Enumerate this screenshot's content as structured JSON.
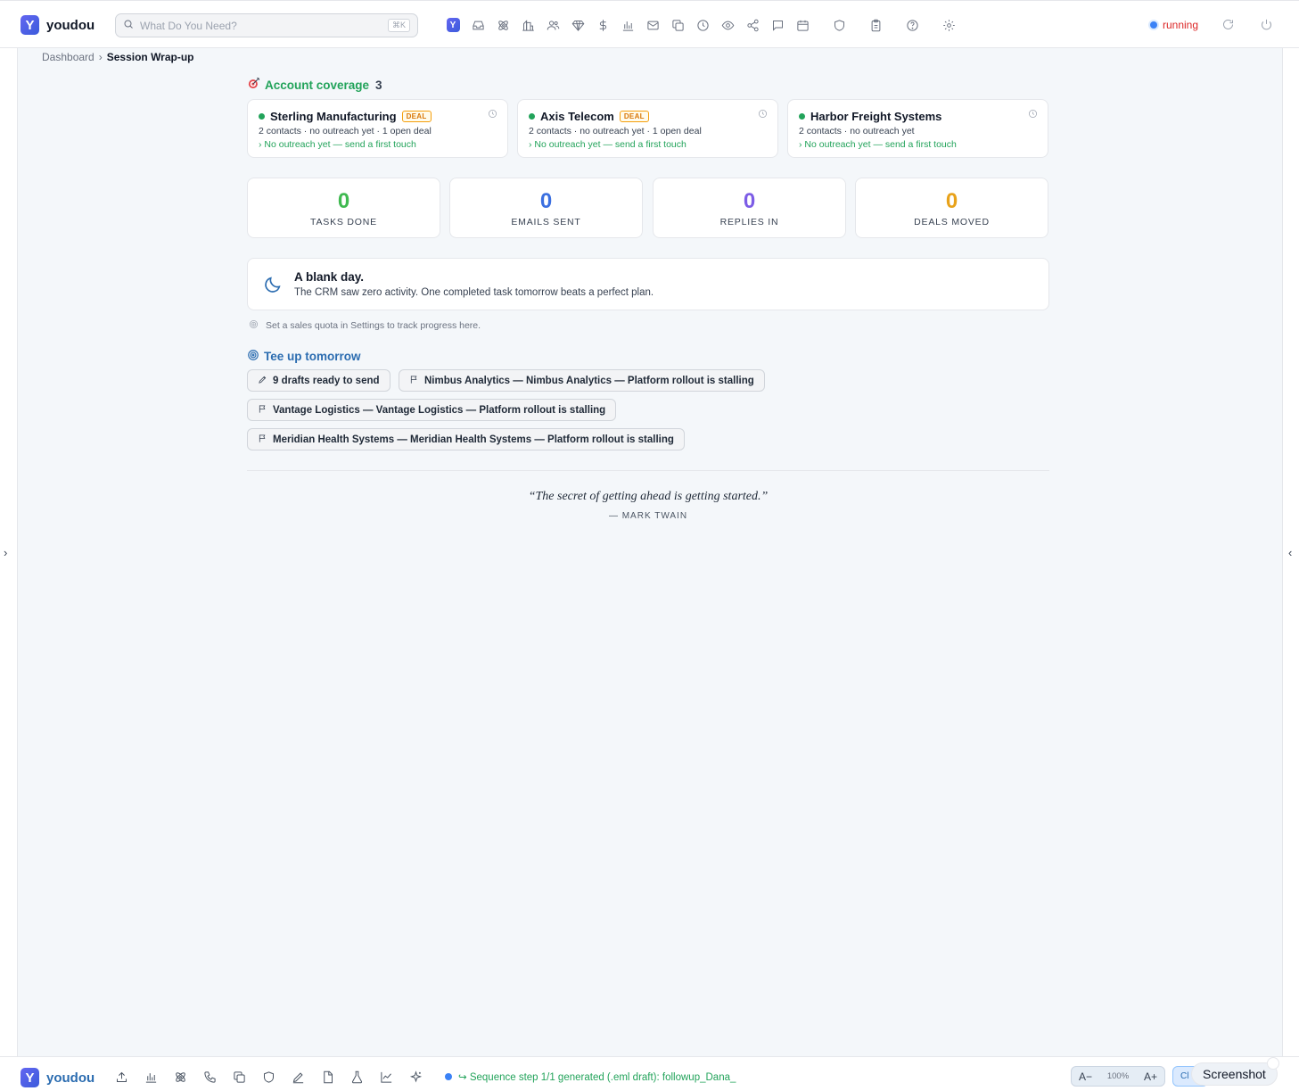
{
  "app": {
    "name": "youdou",
    "logo_letter": "Y"
  },
  "search": {
    "placeholder": "What Do You Need?",
    "shortcut": "⌘K"
  },
  "status": {
    "label": "running"
  },
  "breadcrumb": {
    "parent": "Dashboard",
    "separator": "›",
    "current": "Session Wrap-up"
  },
  "coverage": {
    "title": "Account coverage",
    "count": "3",
    "accounts": [
      {
        "name": "Sterling Manufacturing",
        "badge": "DEAL",
        "meta": "2 contacts · no outreach yet · 1 open deal",
        "hint": "› No outreach yet — send a first touch"
      },
      {
        "name": "Axis Telecom",
        "badge": "DEAL",
        "meta": "2 contacts · no outreach yet · 1 open deal",
        "hint": "› No outreach yet — send a first touch"
      },
      {
        "name": "Harbor Freight Systems",
        "badge": "",
        "meta": "2 contacts · no outreach yet",
        "hint": "› No outreach yet — send a first touch"
      }
    ]
  },
  "stats": [
    {
      "value": "0",
      "label": "TASKS DONE",
      "color": "#3fb950"
    },
    {
      "value": "0",
      "label": "EMAILS SENT",
      "color": "#3b6fe0"
    },
    {
      "value": "0",
      "label": "REPLIES IN",
      "color": "#7c5ce6"
    },
    {
      "value": "0",
      "label": "DEALS MOVED",
      "color": "#e8a21a"
    }
  ],
  "blank_day": {
    "title": "A blank day.",
    "text": "The CRM saw zero activity. One completed task tomorrow beats a perfect plan."
  },
  "quota_note": "Set a sales quota in Settings to track progress here.",
  "tee_up": {
    "title": "Tee up tomorrow",
    "chips": [
      {
        "label": "9 drafts ready to send",
        "icon": "pencil-icon"
      },
      {
        "label": "Nimbus Analytics — Nimbus Analytics — Platform rollout is stalling",
        "icon": "flag-icon"
      },
      {
        "label": "Vantage Logistics — Vantage Logistics — Platform rollout is stalling",
        "icon": "flag-icon"
      },
      {
        "label": "Meridian Health Systems — Meridian Health Systems — Platform rollout is stalling",
        "icon": "flag-icon"
      }
    ]
  },
  "quote": {
    "text": "“The secret of getting ahead is getting started.”",
    "author": "— MARK TWAIN"
  },
  "bottom": {
    "sequence_status": "↪ Sequence step 1/1 generated (.eml draft): followup_Dana_",
    "zoom_out": "A−",
    "zoom_value": "100%",
    "zoom_in": "A+",
    "clip_label": "Cl",
    "screenshot_label": "Screenshot"
  },
  "icons": {
    "top_nav": [
      "youdou-icon",
      "inbox-icon",
      "atom-icon",
      "building-icon",
      "users-icon",
      "gem-icon",
      "dollar-icon",
      "bar-chart-icon",
      "mail-icon",
      "copy-icon",
      "clock-icon",
      "eye-icon",
      "share-icon",
      "message-icon",
      "calendar-icon",
      "shield-icon",
      "clipboard-icon",
      "help-icon",
      "gear-icon"
    ],
    "bottom_nav": [
      "upload-icon",
      "bar-chart-icon",
      "atom-icon",
      "phone-icon",
      "copy-icon",
      "shield-icon",
      "pen-icon",
      "file-icon",
      "flask-icon",
      "line-chart-icon",
      "sparkle-icon"
    ]
  }
}
